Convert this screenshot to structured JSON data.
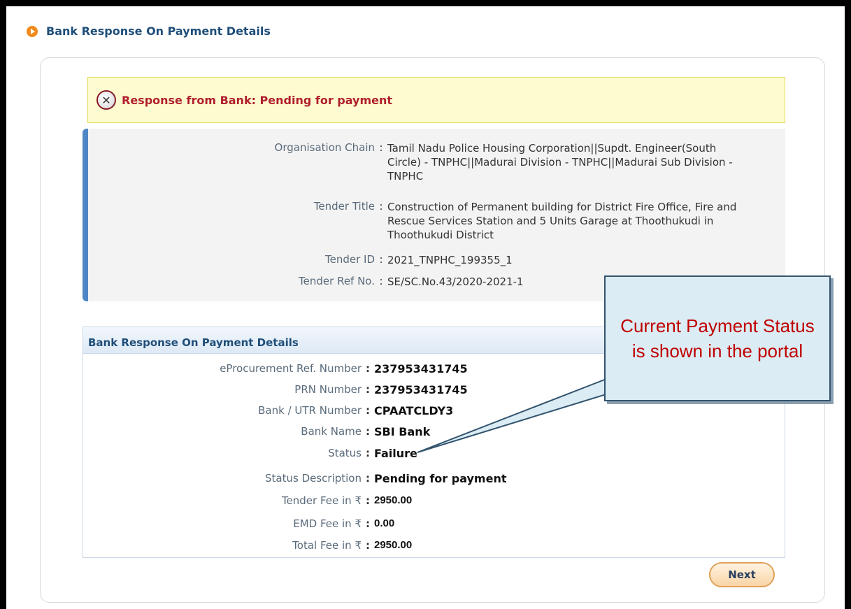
{
  "page": {
    "title": "Bank Response On Payment Details"
  },
  "alert": {
    "text": "Response from Bank: Pending for payment"
  },
  "tender_info": [
    {
      "label": "Organisation Chain",
      "value": "Tamil Nadu Police Housing Corporation||Supdt. Engineer(South Circle) - TNPHC||Madurai Division - TNPHC||Madurai Sub Division - TNPHC"
    },
    {
      "label": "Tender Title",
      "value": "Construction of Permanent building for District Fire Office, Fire and Rescue Services Station and 5 Units Garage at Thoothukudi in Thoothukudi District"
    },
    {
      "label": "Tender ID",
      "value": "2021_TNPHC_199355_1"
    },
    {
      "label": "Tender Ref No.",
      "value": "SE/SC.No.43/2020-2021-1"
    }
  ],
  "details": {
    "heading": "Bank Response On Payment Details",
    "rows": [
      {
        "label": "eProcurement Ref. Number",
        "value": "237953431745"
      },
      {
        "label": "PRN Number",
        "value": "237953431745"
      },
      {
        "label": "Bank / UTR Number",
        "value": "CPAATCLDY3"
      },
      {
        "label": "Bank Name",
        "value": "SBI Bank"
      },
      {
        "label": "Status",
        "value": "Failure"
      },
      {
        "label": "Status Description",
        "value": "Pending for payment"
      },
      {
        "label": "Tender Fee in ₹",
        "value": "2950.00"
      },
      {
        "label": "EMD Fee in ₹",
        "value": "0.00"
      },
      {
        "label": "Total Fee in ₹",
        "value": "2950.00"
      }
    ]
  },
  "next_button": {
    "label": "Next"
  },
  "callout": {
    "text": "Current Payment Status is shown in the portal"
  },
  "colors": {
    "accent": "#1f4e79",
    "alert_text": "#b01f2e",
    "callout_text": "#c00000",
    "button_border": "#e0a25a"
  }
}
